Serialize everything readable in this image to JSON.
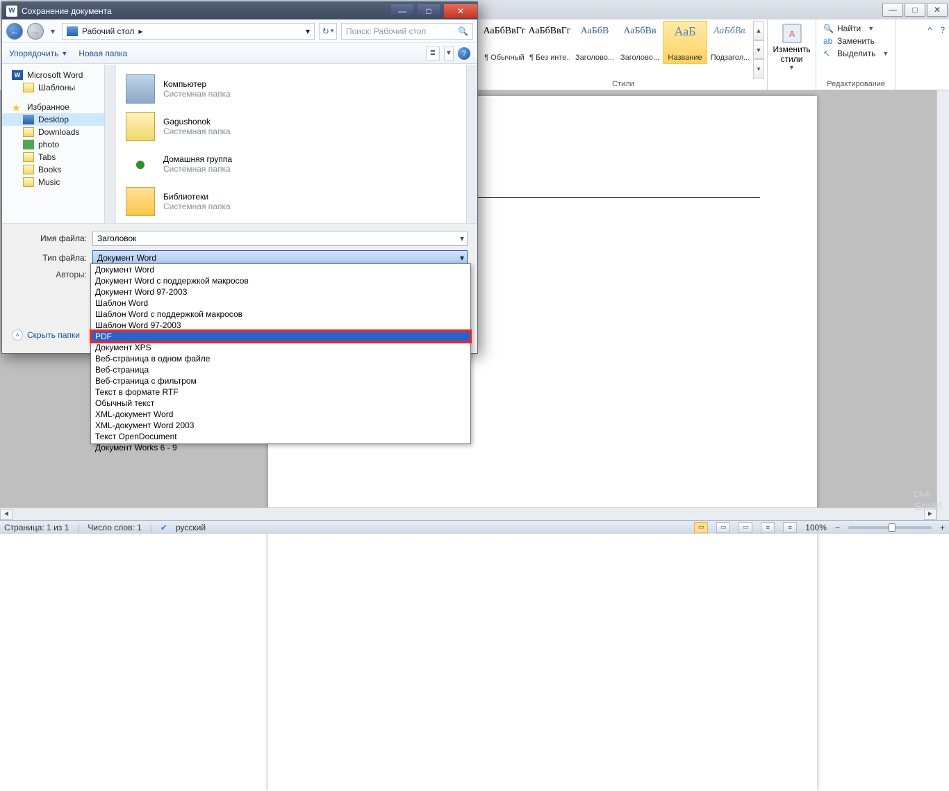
{
  "window": {
    "min": "—",
    "max": "□",
    "close": "✕"
  },
  "ribbon_help": {
    "help": "?",
    "collapse": "^"
  },
  "styles": {
    "group_label": "Стили",
    "tiles": [
      {
        "preview": "АаБбВвГг",
        "name": "¶ Обычный"
      },
      {
        "preview": "АаБбВвГг",
        "name": "¶ Без инте..."
      },
      {
        "preview": "АаБбВ",
        "name": "Заголово..."
      },
      {
        "preview": "АаБбВв",
        "name": "Заголово..."
      },
      {
        "preview": "АаБ",
        "name": "Название"
      },
      {
        "preview": "АаБбВв.",
        "name": "Подзагол..."
      }
    ],
    "change_label": "Изменить\nстили"
  },
  "edit_group": {
    "label": "Редактирование",
    "find": "Найти",
    "replace": "Заменить",
    "select": "Выделить"
  },
  "statusbar": {
    "page": "Страница: 1 из 1",
    "words": "Число слов: 1",
    "lang": "русский",
    "zoom": "100%",
    "minus": "−",
    "plus": "+"
  },
  "dialog": {
    "title": "Сохранение документа",
    "back": "←",
    "fwd": "→",
    "dd": "▾",
    "breadcrumb_text": "Рабочий стол",
    "breadcrumb_arrow": "▸",
    "refresh": "↻",
    "refresh_dd": "▾",
    "search_placeholder": "Поиск: Рабочий стол",
    "search_icon": "🔍",
    "organize": "Упорядочить",
    "organize_dd": "▼",
    "newfolder": "Новая папка",
    "view_marker": "≣",
    "view_dd": "▼",
    "help": "?"
  },
  "left_tree": {
    "ms_word": "Microsoft Word",
    "templates": "Шаблоны",
    "favorites": "Избранное",
    "desktop": "Desktop",
    "downloads": "Downloads",
    "photo": "photo",
    "tabs": "Tabs",
    "books": "Books",
    "music": "Music"
  },
  "right_list": {
    "sys": "Системная папка",
    "computer": "Компьютер",
    "user": "Gagushonok",
    "homegroup": "Домашняя группа",
    "library": "Библиотеки"
  },
  "form": {
    "filename_label": "Имя файла:",
    "filename_value": "Заголовок",
    "filetype_label": "Тип файла:",
    "filetype_value": "Документ Word",
    "authors_label": "Авторы:",
    "hide_folders": "Скрыть папки"
  },
  "filetypes": [
    "Документ Word",
    "Документ Word с поддержкой макросов",
    "Документ Word 97-2003",
    "Шаблон Word",
    "Шаблон Word с поддержкой макросов",
    "Шаблон Word 97-2003",
    "PDF",
    "Документ XPS",
    "Веб-страница в одном файле",
    "Веб-страница",
    "Веб-страница с фильтром",
    "Текст в формате RTF",
    "Обычный текст",
    "XML-документ Word",
    "XML-документ Word 2003",
    "Текст OpenDocument",
    "Документ Works 6 - 9"
  ],
  "watermark": {
    "top": "Club",
    "bottom": "Sovet"
  }
}
